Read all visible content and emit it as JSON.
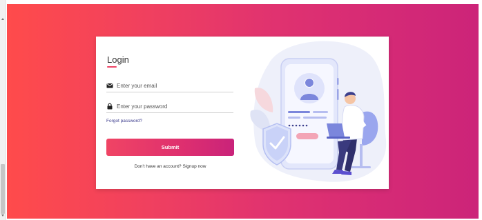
{
  "colors": {
    "gradient_start": "#ff4b4b",
    "gradient_end": "#cc2479",
    "accent": "#ee4465",
    "link": "#3a3a8c"
  },
  "login": {
    "title": "Login",
    "email": {
      "placeholder": "Enter your email",
      "value": "",
      "icon": "envelope-icon"
    },
    "password": {
      "placeholder": "Enter your password",
      "value": "",
      "icon": "lock-icon"
    },
    "forgot_label": "Forgot password?",
    "submit_label": "Submit",
    "signup_text": "Don't have an account? Signup now"
  },
  "illustration": {
    "icons": [
      "user-avatar-icon",
      "shield-check-icon",
      "person-with-laptop-icon"
    ]
  }
}
